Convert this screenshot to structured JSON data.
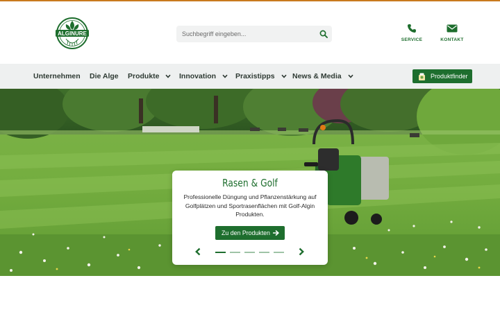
{
  "brand": {
    "logo_text": "ALGINURE",
    "accent": "#1e6e2e",
    "top_strip": "#c97a1e"
  },
  "search": {
    "placeholder": "Suchbegriff eingeben...",
    "icon": "search-icon"
  },
  "utility": {
    "service": {
      "label": "SERVICE",
      "icon": "phone-icon"
    },
    "kontakt": {
      "label": "KONTAKT",
      "icon": "envelope-icon"
    }
  },
  "nav": {
    "items": [
      {
        "label": "Unternehmen",
        "dropdown": false
      },
      {
        "label": "Die Alge",
        "dropdown": false
      },
      {
        "label": "Produkte",
        "dropdown": true
      },
      {
        "label": "Innovation",
        "dropdown": true
      },
      {
        "label": "Praxistipps",
        "dropdown": true
      },
      {
        "label": "News & Media",
        "dropdown": true
      }
    ],
    "finder": {
      "label": "Produktfinder",
      "icon": "product-finder-icon"
    }
  },
  "hero": {
    "slide": {
      "title": "Rasen & Golf",
      "text": "Professionelle Düngung und Pflanzenstärkung auf Golfplätzen und Sportrasenflächen mit Golf-Algin Produkten.",
      "cta_label": "Zu den Produkten"
    },
    "slide_count": 5,
    "active_slide": 1
  }
}
